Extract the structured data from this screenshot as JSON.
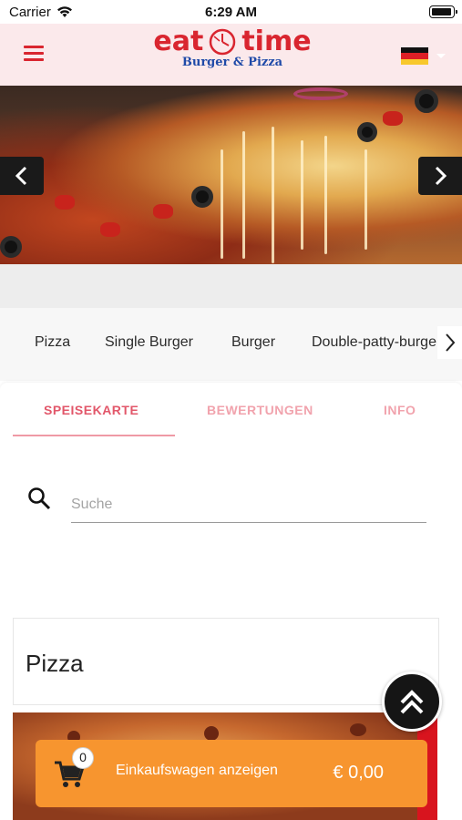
{
  "status_bar": {
    "carrier": "Carrier",
    "time": "6:29 AM"
  },
  "header": {
    "logo_word_left": "eat",
    "logo_word_right": "time",
    "logo_sub": "Burger & Pizza",
    "brand_red": "#d9252f",
    "brand_blue": "#1f4aa8",
    "language_flag": "de-flag-icon"
  },
  "categories": [
    "Pizza",
    "Single Burger",
    "Burger",
    "Double-patty-burger"
  ],
  "tabs": [
    {
      "label": "SPEISEKARTE",
      "active": true
    },
    {
      "label": "BEWERTUNGEN",
      "active": false
    },
    {
      "label": "INFO",
      "active": false
    }
  ],
  "search": {
    "placeholder": "Suche",
    "value": ""
  },
  "section": {
    "title": "Pizza"
  },
  "cart": {
    "count": "0",
    "label": "Einkaufswagen anzeigen",
    "total": "€ 0,00",
    "color": "#f7952f"
  }
}
